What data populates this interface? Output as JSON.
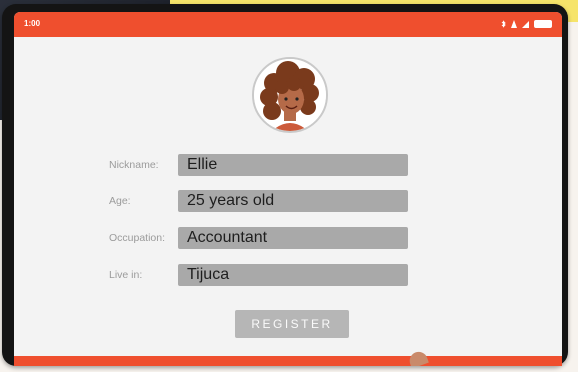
{
  "status_bar": {
    "left_text": "1:00",
    "icons": [
      "bluetooth-icon",
      "alarm-icon",
      "signal-icon",
      "battery-icon"
    ],
    "color": "#ef4f2e"
  },
  "profile": {
    "avatar": "woman-curly-hair-avatar"
  },
  "form": {
    "fields": [
      {
        "label": "Nickname:",
        "value": "Ellie"
      },
      {
        "label": "Age:",
        "value": "25 years old"
      },
      {
        "label": "Occupation:",
        "value": "Accountant"
      },
      {
        "label": "Live in:",
        "value": "Tijuca"
      }
    ],
    "register_label": "REGISTER"
  },
  "colors": {
    "accent": "#ef4f2e",
    "field_bg": "#a9a9a9",
    "button_bg": "#b6b6b6"
  }
}
